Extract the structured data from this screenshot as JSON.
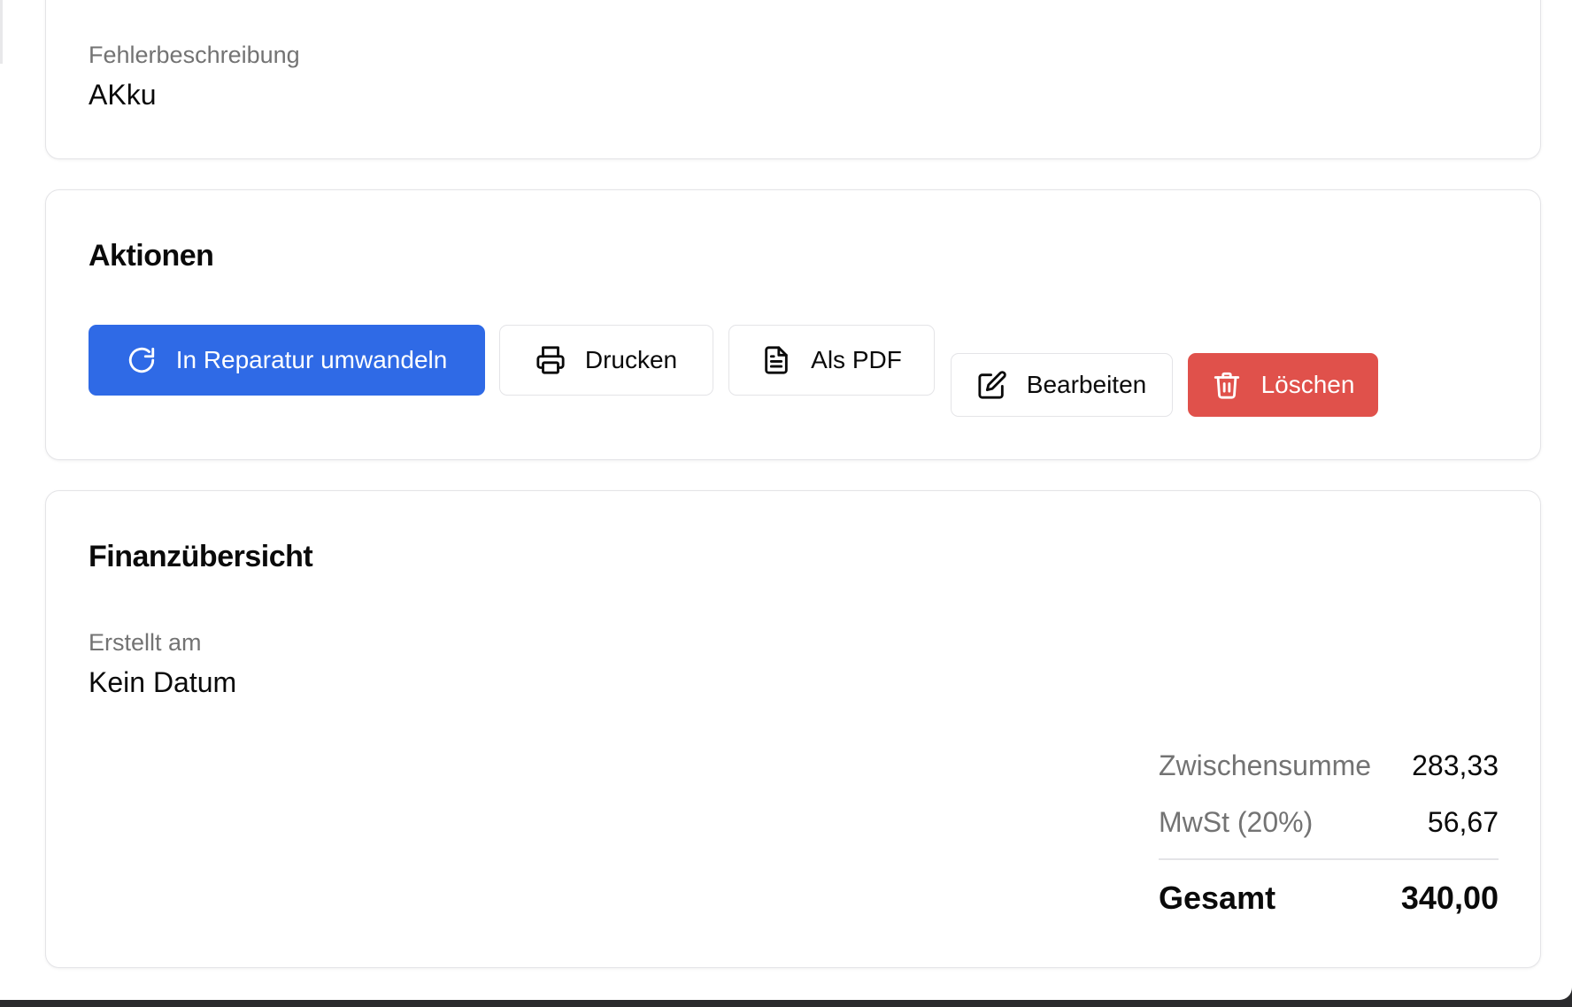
{
  "details": {
    "error_description_label": "Fehlerbeschreibung",
    "error_description_value": "AKku"
  },
  "actions": {
    "title": "Aktionen",
    "buttons": {
      "convert": "In Reparatur umwandeln",
      "print": "Drucken",
      "pdf": "Als PDF",
      "edit": "Bearbeiten",
      "delete": "Löschen"
    },
    "icons": {
      "convert": "refresh-icon",
      "print": "printer-icon",
      "pdf": "document-icon",
      "edit": "edit-icon",
      "delete": "trash-icon"
    },
    "colors": {
      "primary": "#2f6ae6",
      "danger": "#e0514b"
    }
  },
  "finance": {
    "title": "Finanzübersicht",
    "created_label": "Erstellt am",
    "created_value": "Kein Datum",
    "subtotal_label": "Zwischensumme",
    "subtotal_value": "283,33",
    "tax_label": "MwSt (20%)",
    "tax_value": "56,67",
    "total_label": "Gesamt",
    "total_value": "340,00"
  }
}
